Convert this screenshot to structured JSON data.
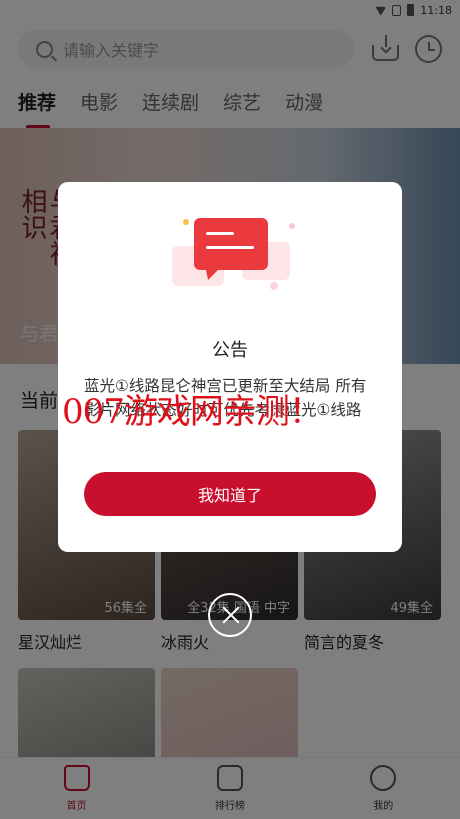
{
  "status_bar": {
    "time": "11:18"
  },
  "search": {
    "placeholder": "请输入关键字"
  },
  "tabs": [
    {
      "label": "推荐",
      "active": true
    },
    {
      "label": "电影"
    },
    {
      "label": "连续剧"
    },
    {
      "label": "综艺"
    },
    {
      "label": "动漫"
    }
  ],
  "banner": {
    "title": "与君",
    "calligraphy": "与君初相识"
  },
  "section": {
    "title": "当前"
  },
  "cards": [
    {
      "title": "星汉灿烂",
      "episodes": "56集全",
      "colors": [
        "#5a4a3e",
        "#b7a594"
      ]
    },
    {
      "title": "冰雨火",
      "episodes": "全32集 国语 中字",
      "colors": [
        "#2e2a2c",
        "#7d6c5e"
      ]
    },
    {
      "title": "简言的夏冬",
      "episodes": "49集全",
      "colors": [
        "#3b3a3c",
        "#9d9a98"
      ]
    },
    {
      "title": "",
      "episodes": "",
      "colors": [
        "#6b6a67",
        "#c9c5bd"
      ]
    },
    {
      "title": "",
      "episodes": "",
      "colors": [
        "#d9a8b2",
        "#e9d4c7"
      ]
    }
  ],
  "modal": {
    "title": "公告",
    "body": "蓝光①线路昆仑神宫已更新至大结局 所有影片网络状态好时可优先考虑蓝光①线路",
    "button_label": "我知道了"
  },
  "watermark": "007游戏网亲测！",
  "bottom_nav": [
    {
      "label": "首页",
      "active": true,
      "icon": "home-icon"
    },
    {
      "label": "排行榜",
      "active": false,
      "icon": "chart-icon"
    },
    {
      "label": "我的",
      "active": false,
      "icon": "profile-icon"
    }
  ],
  "colors": {
    "accent": "#c8102e"
  }
}
